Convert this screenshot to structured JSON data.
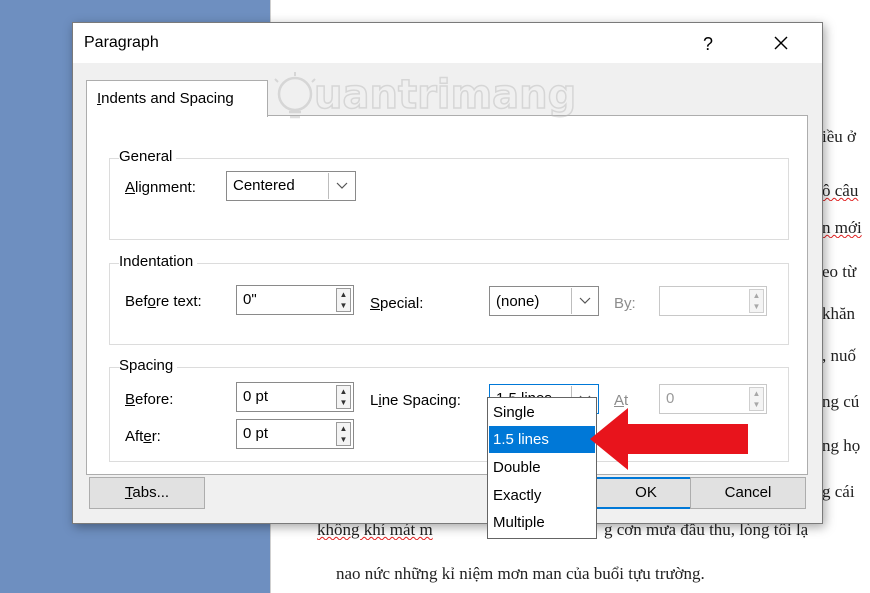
{
  "dialog": {
    "title": "Paragraph",
    "help_label": "?",
    "close_label": "✕",
    "tab_label": "Indents and Spacing"
  },
  "general": {
    "title": "General",
    "alignment_label": "Alignment:",
    "alignment_value": "Centered"
  },
  "indentation": {
    "title": "Indentation",
    "before_text_label": "Before text:",
    "before_text_value": "0\"",
    "special_label": "Special:",
    "special_value": "(none)",
    "by_label": "By:",
    "by_value": ""
  },
  "spacing": {
    "title": "Spacing",
    "before_label": "Before:",
    "before_value": "0 pt",
    "after_label": "After:",
    "after_value": "0 pt",
    "line_spacing_label": "Line Spacing:",
    "line_spacing_value": "1.5 lines",
    "at_label": "At",
    "at_value": "0",
    "line_spacing_options": [
      "Single",
      "1.5 lines",
      "Double",
      "Exactly",
      "Multiple"
    ],
    "selected_index": 1
  },
  "buttons": {
    "tabs_label": "Tabs...",
    "ok_label": "OK",
    "cancel_label": "Cancel"
  },
  "watermark": {
    "text": "uantrimang"
  },
  "document": {
    "right_fragments": [
      "iều ở",
      "ô câu",
      "n mới",
      "eo từ",
      "khăn",
      ", nuố",
      "ng cú",
      "ng họ",
      "g cái"
    ],
    "line_1a": "không khí mát m",
    "line_1b": "g cơn mưa đầu thu, lòng tôi lạ",
    "line_2": "nao nức những kỉ niệm mơn man của buổi tựu trường."
  },
  "colors": {
    "selection": "#0078d7",
    "arrow": "#e8141c",
    "workspace": "#6e8fc0"
  }
}
